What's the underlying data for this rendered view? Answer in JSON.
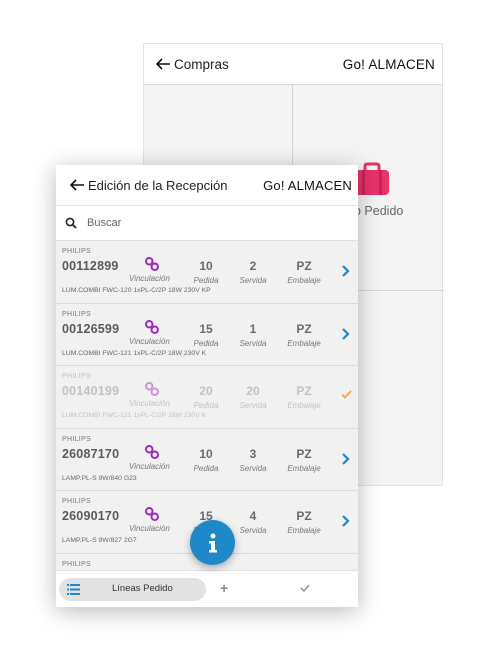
{
  "back": {
    "title": "Compras",
    "brand": "Go! ALMACEN",
    "tile_label": "o Pedido"
  },
  "front": {
    "title": "Edición de la Recepción",
    "brand": "Go! ALMACEN",
    "search_placeholder": "Buscar",
    "rows": [
      {
        "brand": "PHILIPS",
        "code": "00112899",
        "link_label": "Vinculación",
        "pedida": "10",
        "pedida_label": "Pedida",
        "servida": "2",
        "servida_label": "Servida",
        "embalaje": "PZ",
        "embalaje_label": "Embalaje",
        "desc": "LUM.COMBI FWC-120 1xPL-C/2P 18W 230V KP"
      },
      {
        "brand": "PHILIPS",
        "code": "00126599",
        "link_label": "Vinculación",
        "pedida": "15",
        "pedida_label": "Pedida",
        "servida": "1",
        "servida_label": "Servida",
        "embalaje": "PZ",
        "embalaje_label": "Embalaje",
        "desc": "LUM.COMBI FWC-121 1xPL-C/2P 18W 230V K"
      },
      {
        "brand": "PHILIPS",
        "code": "00140199",
        "link_label": "Vinculación",
        "pedida": "20",
        "pedida_label": "Pedida",
        "servida": "20",
        "servida_label": "Servida",
        "embalaje": "PZ",
        "embalaje_label": "Embalaje",
        "desc": "LUM.COMBI FWC-121 1xPL-C/2P 18W 230V K"
      },
      {
        "brand": "PHILIPS",
        "code": "26087170",
        "link_label": "Vinculación",
        "pedida": "10",
        "pedida_label": "Pedida",
        "servida": "3",
        "servida_label": "Servida",
        "embalaje": "PZ",
        "embalaje_label": "Embalaje",
        "desc": "LAMP.PL-S 9W/840 G23"
      },
      {
        "brand": "PHILIPS",
        "code": "26090170",
        "link_label": "Vinculación",
        "pedida": "15",
        "pedida_label": "Pedida",
        "servida": "4",
        "servida_label": "Servida",
        "embalaje": "PZ",
        "embalaje_label": "Embalaje",
        "desc": "LAMP.PL-S 9W/827 2G7"
      },
      {
        "brand": "PHILIPS"
      }
    ],
    "bottom_tab_label": "Líneas Pedido",
    "plus_symbol": "+"
  },
  "colors": {
    "accent_blue": "#1e88c8",
    "link_purple": "#9c2bbf",
    "case_pink": "#e8326a",
    "check_orange": "#f4a23c"
  },
  "icons": [
    "back-arrow-icon",
    "search-icon",
    "link-icon",
    "chevron-right-icon",
    "check-icon",
    "list-icon",
    "plus-icon",
    "info-icon",
    "suitcase-icon"
  ]
}
